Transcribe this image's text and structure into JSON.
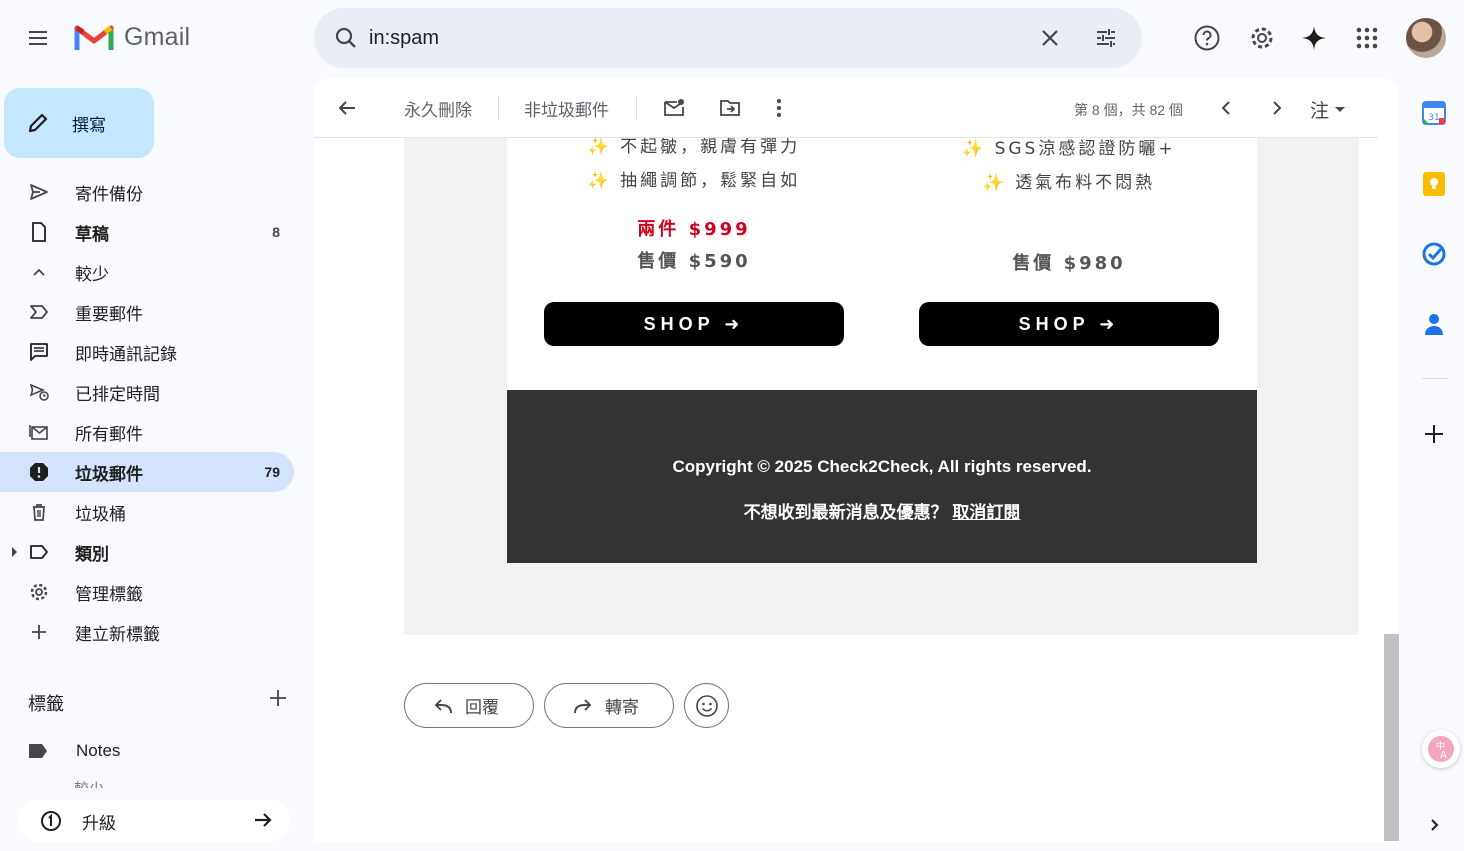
{
  "app": {
    "name": "Gmail"
  },
  "search": {
    "value": "in:spam"
  },
  "compose": {
    "label": "撰寫"
  },
  "nav": {
    "items": [
      {
        "label": "寄件備份",
        "count": ""
      },
      {
        "label": "草稿",
        "count": "8"
      },
      {
        "label": "較少",
        "count": ""
      },
      {
        "label": "重要郵件",
        "count": ""
      },
      {
        "label": "即時通訊記錄",
        "count": ""
      },
      {
        "label": "已排定時間",
        "count": ""
      },
      {
        "label": "所有郵件",
        "count": ""
      },
      {
        "label": "垃圾郵件",
        "count": "79"
      },
      {
        "label": "垃圾桶",
        "count": ""
      },
      {
        "label": "類別",
        "count": ""
      },
      {
        "label": "管理標籤",
        "count": ""
      },
      {
        "label": "建立新標籤",
        "count": ""
      }
    ],
    "active": "垃圾郵件"
  },
  "labels": {
    "header": "標籤",
    "items": [
      "Notes"
    ],
    "less": "較少"
  },
  "upgrade": {
    "label": "升級"
  },
  "toolbar": {
    "delete_forever": "永久刪除",
    "not_spam": "非垃圾郵件",
    "pager": "第 8 個，共 82 個",
    "lang": "注"
  },
  "email": {
    "product_left": {
      "features": [
        "不起皺，親膚有彈力",
        "抽繩調節，鬆緊自如"
      ],
      "promo": "兩件 $999",
      "price": "售價 $590",
      "shop": "SHOP ➜"
    },
    "product_right": {
      "features": [
        "SGS涼感認證防曬+",
        "透氣布料不悶熱"
      ],
      "price": "售價 $980",
      "shop": "SHOP ➜"
    },
    "footer": {
      "copyright": "Copyright © 2025 Check2Check, All rights reserved.",
      "unsub_text": "不想收到最新消息及優惠？",
      "unsub_link": "取消訂閱"
    }
  },
  "actions": {
    "reply": "回覆",
    "forward": "轉寄"
  },
  "colors": {
    "compose_bg": "#c2e7ff",
    "active_nav": "#d3e3fd",
    "search_bg": "#e9eef6",
    "promo_red": "#d0021b",
    "footer_bg": "#333333"
  }
}
